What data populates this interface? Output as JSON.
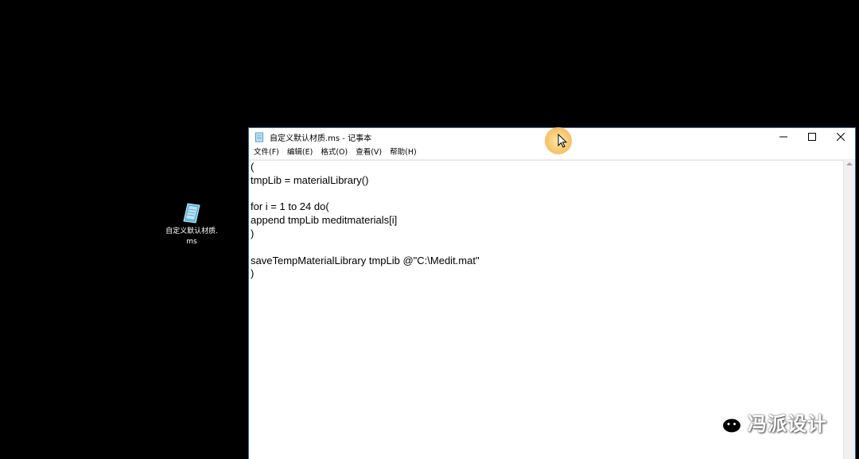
{
  "desktop": {
    "icon": {
      "icon_name": "script-file-icon",
      "label": "自定义默认材质.ms"
    }
  },
  "window": {
    "title": "自定义默认材质.ms - 记事本",
    "app_icon": "notepad-icon",
    "controls": {
      "minimize": "minimize-icon",
      "maximize": "maximize-icon",
      "close": "close-icon"
    },
    "menu": [
      {
        "label": "文件(F)"
      },
      {
        "label": "编辑(E)"
      },
      {
        "label": "格式(O)"
      },
      {
        "label": "查看(V)"
      },
      {
        "label": "帮助(H)"
      }
    ],
    "content_lines": [
      "(",
      "tmpLib = materialLibrary()",
      "",
      "for i = 1 to 24 do(",
      "append tmpLib meditmaterials[i]",
      ")",
      "",
      "saveTempMaterialLibrary tmpLib @\"C:\\Medit.mat\"",
      ")"
    ]
  },
  "watermark": {
    "icon_name": "wechat-icon",
    "text": "冯派设计"
  },
  "colors": {
    "desktop_bg": "#000000",
    "window_bg": "#ffffff",
    "cursor_highlight": "#f7c56a"
  }
}
